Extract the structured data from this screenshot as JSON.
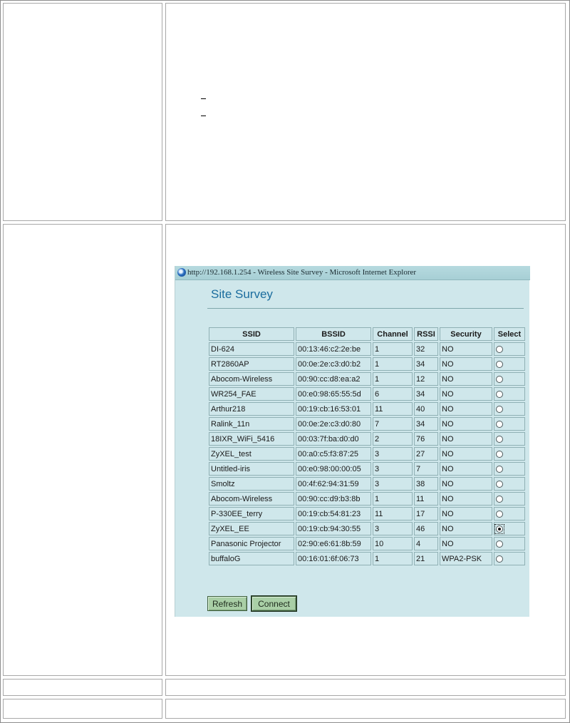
{
  "window": {
    "title": "http://192.168.1.254 - Wireless Site Survey - Microsoft Internet Explorer"
  },
  "site_survey": {
    "heading": "Site Survey",
    "columns": [
      "SSID",
      "BSSID",
      "Channel",
      "RSSI",
      "Security",
      "Select"
    ],
    "rows": [
      {
        "ssid": "DI-624",
        "bssid": "00:13:46:c2:2e:be",
        "channel": "1",
        "rssi": "32",
        "security": "NO",
        "selected": false
      },
      {
        "ssid": "RT2860AP",
        "bssid": "00:0e:2e:c3:d0:b2",
        "channel": "1",
        "rssi": "34",
        "security": "NO",
        "selected": false
      },
      {
        "ssid": "Abocom-Wireless",
        "bssid": "00:90:cc:d8:ea:a2",
        "channel": "1",
        "rssi": "12",
        "security": "NO",
        "selected": false
      },
      {
        "ssid": "WR254_FAE",
        "bssid": "00:e0:98:65:55:5d",
        "channel": "6",
        "rssi": "34",
        "security": "NO",
        "selected": false
      },
      {
        "ssid": "Arthur218",
        "bssid": "00:19:cb:16:53:01",
        "channel": "11",
        "rssi": "40",
        "security": "NO",
        "selected": false
      },
      {
        "ssid": "Ralink_11n",
        "bssid": "00:0e:2e:c3:d0:80",
        "channel": "7",
        "rssi": "34",
        "security": "NO",
        "selected": false
      },
      {
        "ssid": "18IXR_WiFi_5416",
        "bssid": "00:03:7f:ba:d0:d0",
        "channel": "2",
        "rssi": "76",
        "security": "NO",
        "selected": false
      },
      {
        "ssid": "ZyXEL_test",
        "bssid": "00:a0:c5:f3:87:25",
        "channel": "3",
        "rssi": "27",
        "security": "NO",
        "selected": false
      },
      {
        "ssid": "Untitled-iris",
        "bssid": "00:e0:98:00:00:05",
        "channel": "3",
        "rssi": "7",
        "security": "NO",
        "selected": false
      },
      {
        "ssid": "Smoltz",
        "bssid": "00:4f:62:94:31:59",
        "channel": "3",
        "rssi": "38",
        "security": "NO",
        "selected": false
      },
      {
        "ssid": "Abocom-Wireless",
        "bssid": "00:90:cc:d9:b3:8b",
        "channel": "1",
        "rssi": "11",
        "security": "NO",
        "selected": false
      },
      {
        "ssid": "P-330EE_terry",
        "bssid": "00:19:cb:54:81:23",
        "channel": "11",
        "rssi": "17",
        "security": "NO",
        "selected": false
      },
      {
        "ssid": "ZyXEL_EE",
        "bssid": "00:19:cb:94:30:55",
        "channel": "3",
        "rssi": "46",
        "security": "NO",
        "selected": true
      },
      {
        "ssid": "Panasonic Projector",
        "bssid": "02:90:e6:61:8b:59",
        "channel": "10",
        "rssi": "4",
        "security": "NO",
        "selected": false
      },
      {
        "ssid": "buffaloG",
        "bssid": "00:16:01:6f:06:73",
        "channel": "1",
        "rssi": "21",
        "security": "WPA2-PSK",
        "selected": false
      }
    ],
    "buttons": {
      "refresh": "Refresh",
      "connect": "Connect"
    }
  }
}
